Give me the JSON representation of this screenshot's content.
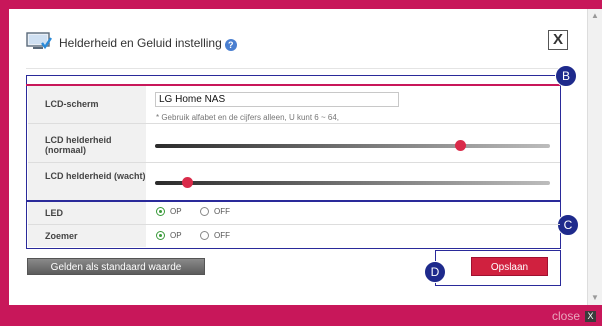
{
  "dialog": {
    "title": "Helderheid en Geluid instelling",
    "help_icon": "help-icon",
    "close_button": "X",
    "accent_color": "#c8175a"
  },
  "settings": {
    "lcd_screen": {
      "label": "LCD-scherm",
      "value": "LG Home NAS",
      "hint": "* Gebruik alfabet en de cijfers alleen, U kunt 6 ~ 64,"
    },
    "brightness_normal": {
      "label": "LCD helderheid (normaal)",
      "level_fraction": 0.78
    },
    "brightness_wait": {
      "label": "LCD helderheid (wacht)",
      "level_fraction": 0.07
    },
    "led": {
      "label": "LED",
      "options": [
        "OP",
        "OFF"
      ],
      "selected": "OP"
    },
    "buzzer": {
      "label": "Zoemer",
      "options": [
        "OP",
        "OFF"
      ],
      "selected": "OP"
    }
  },
  "annotations": {
    "b": "B",
    "c": "C",
    "d": "D"
  },
  "buttons": {
    "default": "Gelden als standaard waarde",
    "save": "Opslaan"
  },
  "footer": {
    "close_label": "close",
    "close_icon": "X"
  }
}
